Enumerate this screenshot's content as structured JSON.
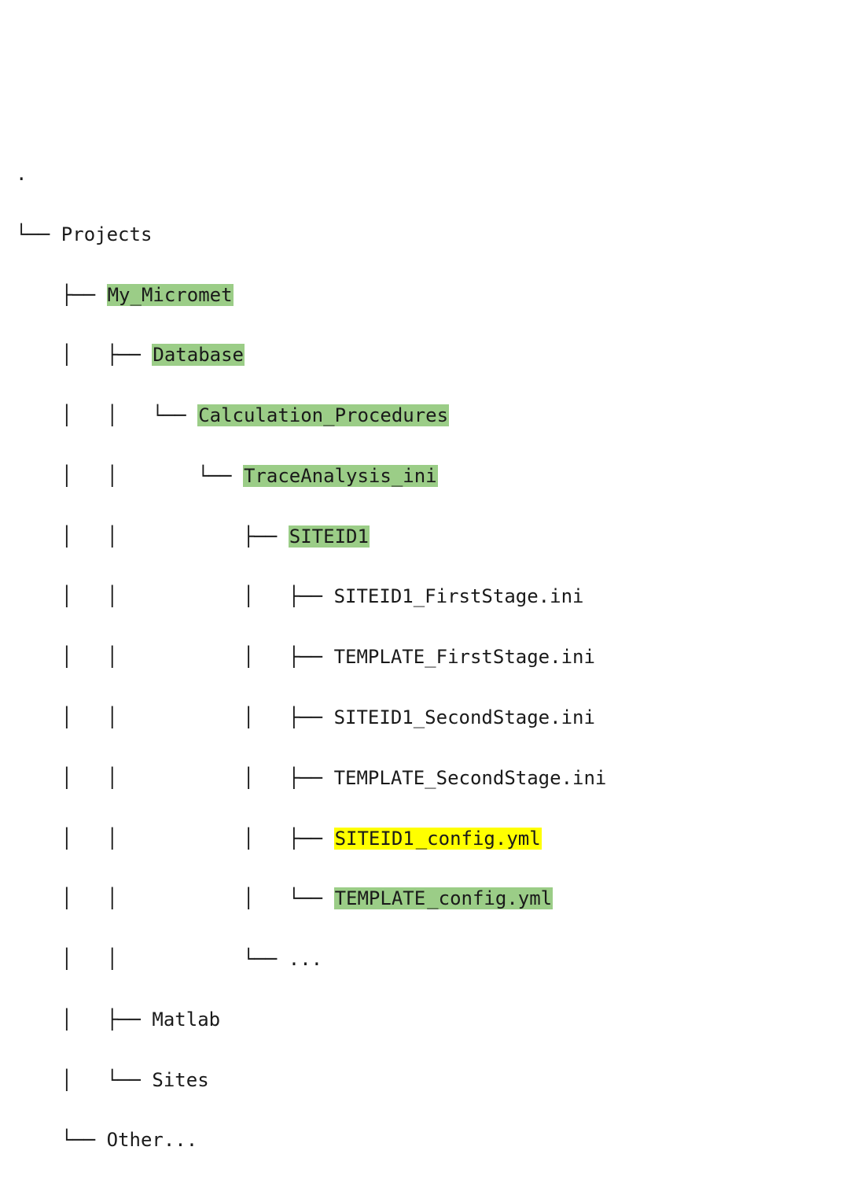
{
  "colors": {
    "highlight_green": "#9bcd87",
    "highlight_yellow": "#ffff00"
  },
  "tree": {
    "root_dot": ".",
    "projects": "Projects",
    "my_micromet": "My_Micromet",
    "database": "Database",
    "calc_proc": "Calculation_Procedures",
    "trace_ini": "TraceAnalysis_ini",
    "siteid1": "SITEID1",
    "file1_a": "SITEID1",
    "file1_b": "_FirstStage.ini",
    "file2_a": "TEMPLATE",
    "file2_b": "_FirstStage.ini",
    "file3_a": "SITEID1",
    "file3_b": "_SecondStage.ini",
    "file4_a": "TEMPLATE",
    "file4_b": "_SecondStage.ini",
    "file5_a": "SITEID1",
    "file5_b": "_config.yml",
    "file6_a": "TEMPLATE",
    "file6_b": "_config.yml",
    "ellipsis": "...",
    "matlab": "Matlab",
    "sites": "Sites",
    "other": "Other..."
  },
  "connectors": {
    "l0": "└── ",
    "l1_mid": "    ├── ",
    "l1_end": "    └── ",
    "l2_mid": "    │   ├── ",
    "l2_end": "    │   └── ",
    "l3": "    │   │   └── ",
    "l4": "    │   │       └── ",
    "l5_mid": "    │   │           ├── ",
    "l5_end": "    │   │           └── ",
    "l6_mid": "    │   │           │   ├── ",
    "l6_end": "    │   │           │   └── "
  }
}
